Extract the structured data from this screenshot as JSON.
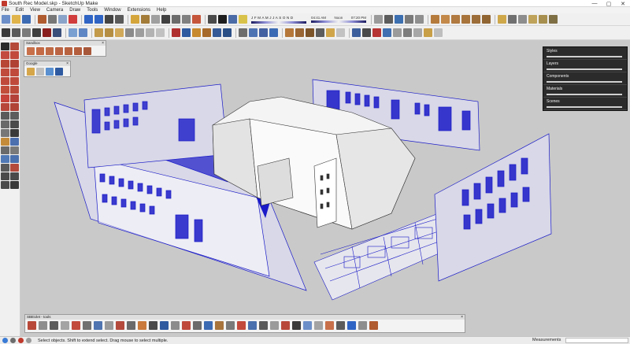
{
  "window": {
    "title": "South Rec Model.skp - SketchUp Make",
    "controls": [
      "—",
      "▢",
      "✕"
    ]
  },
  "menu": [
    "File",
    "Edit",
    "View",
    "Camera",
    "Draw",
    "Tools",
    "Window",
    "Extensions",
    "Help"
  ],
  "shadow": {
    "months": "J F M A M J J A S O N D",
    "time_start": "04:41 AM",
    "time_mid": "Noon",
    "time_end": "07:20 PM"
  },
  "toolbars": {
    "sandbox_title": "Sandbox",
    "google_title": "Google",
    "bottom_title": "SBEUlet - tools",
    "close_glyph": "×"
  },
  "tray": {
    "items": [
      "Styles",
      "Layers",
      "Components",
      "Materials",
      "Scenes"
    ]
  },
  "status": {
    "text": "Select objects. Shift to extend select. Drag mouse to select multiple.",
    "measurements_label": "Measurements"
  },
  "colors": {
    "accent_blue": "#1a1ac8",
    "tray_bg": "#2b2b2b",
    "viewport_bg": "#c9c9c9",
    "toolbar_bg": "#f0f0f0"
  }
}
